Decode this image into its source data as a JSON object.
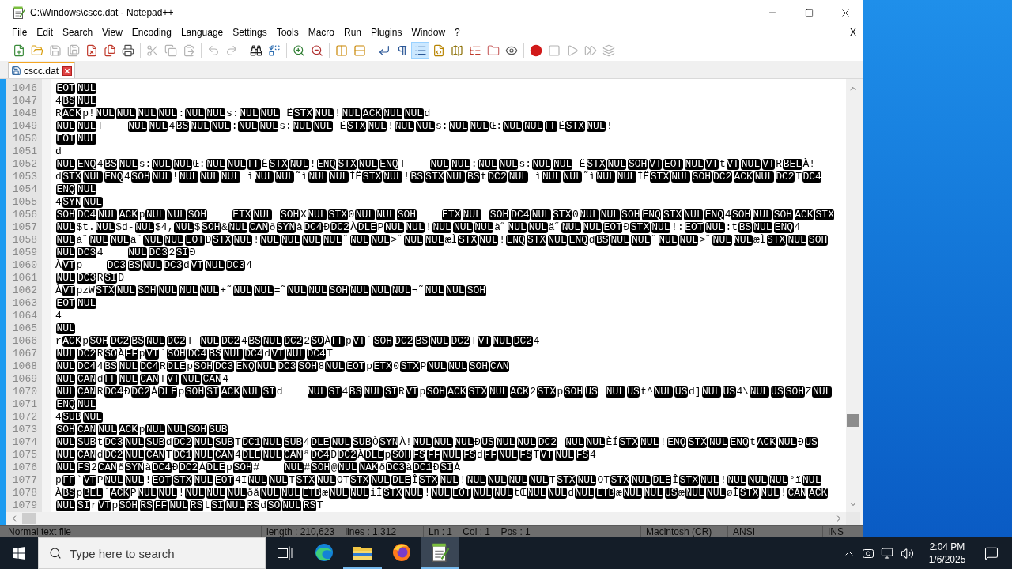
{
  "window": {
    "title": "C:\\Windows\\cscc.dat - Notepad++"
  },
  "menu": {
    "items": [
      "File",
      "Edit",
      "Search",
      "View",
      "Encoding",
      "Language",
      "Settings",
      "Tools",
      "Macro",
      "Run",
      "Plugins",
      "Window",
      "?"
    ],
    "close_glyph": "X"
  },
  "toolbar": [
    [
      {
        "kind": "new",
        "selected": false,
        "disabled": false
      },
      {
        "kind": "open",
        "selected": false,
        "disabled": false
      },
      {
        "kind": "save",
        "selected": false,
        "disabled": true
      },
      {
        "kind": "save-all",
        "selected": false,
        "disabled": true
      },
      {
        "kind": "close",
        "selected": false,
        "disabled": false
      },
      {
        "kind": "close-all",
        "selected": false,
        "disabled": false
      },
      {
        "kind": "print",
        "selected": false,
        "disabled": false
      }
    ],
    [
      {
        "kind": "cut",
        "selected": false,
        "disabled": true
      },
      {
        "kind": "copy",
        "selected": false,
        "disabled": true
      },
      {
        "kind": "paste",
        "selected": false,
        "disabled": true
      }
    ],
    [
      {
        "kind": "undo",
        "selected": false,
        "disabled": true
      },
      {
        "kind": "redo",
        "selected": false,
        "disabled": true
      }
    ],
    [
      {
        "kind": "find",
        "selected": false,
        "disabled": false
      },
      {
        "kind": "replace",
        "selected": false,
        "disabled": false
      }
    ],
    [
      {
        "kind": "zoom-in",
        "selected": false,
        "disabled": false
      },
      {
        "kind": "zoom-out",
        "selected": false,
        "disabled": false
      }
    ],
    [
      {
        "kind": "sync-vertical",
        "selected": false,
        "disabled": false
      },
      {
        "kind": "sync-horizontal",
        "selected": false,
        "disabled": false
      }
    ],
    [
      {
        "kind": "word-wrap",
        "selected": false,
        "disabled": false
      },
      {
        "kind": "all-chars",
        "selected": false,
        "disabled": false
      },
      {
        "kind": "indent-guide",
        "selected": true,
        "disabled": false
      },
      {
        "kind": "user-language",
        "selected": false,
        "disabled": false
      },
      {
        "kind": "doc-map",
        "selected": false,
        "disabled": false
      },
      {
        "kind": "function-list",
        "selected": false,
        "disabled": false
      },
      {
        "kind": "folder-workspace",
        "selected": false,
        "disabled": false
      },
      {
        "kind": "monitoring",
        "selected": false,
        "disabled": false
      }
    ],
    [
      {
        "kind": "record",
        "selected": false,
        "disabled": false
      },
      {
        "kind": "stop",
        "selected": false,
        "disabled": true
      },
      {
        "kind": "play",
        "selected": false,
        "disabled": true
      },
      {
        "kind": "play-multiple",
        "selected": false,
        "disabled": true
      },
      {
        "kind": "save-macro",
        "selected": false,
        "disabled": true
      }
    ]
  ],
  "tabs": [
    {
      "label": "cscc.dat",
      "selected": true
    }
  ],
  "editor": {
    "lines": [
      {
        "number": "1046",
        "tokens": [
          "EOT",
          "NUL"
        ]
      },
      {
        "number": "1047",
        "tokens": [
          {
            "text": "4"
          },
          "BS",
          "NUL"
        ]
      },
      {
        "number": "1048",
        "tokens": [
          {
            "text": "R"
          },
          "ACK",
          {
            "text": "p!"
          },
          "NUL",
          "NUL",
          "NUL",
          "NUL",
          {
            "text": ":"
          },
          "NUL",
          "NUL",
          {
            "text": "s:"
          },
          "NUL",
          {
            "ctrl": "NUL",
            "space_after": true
          },
          {
            "text": "Ë"
          },
          "STX",
          "NUL",
          {
            "text": "!"
          },
          "NUL",
          "ACK",
          "NUL",
          "NUL",
          {
            "text": "d"
          }
        ]
      },
      {
        "number": "1049",
        "tokens": [
          "NUL",
          "NUL",
          {
            "text": "T",
            "tab_after": true
          },
          "NUL",
          "NUL",
          {
            "text": "4"
          },
          "BS",
          "NUL",
          "NUL",
          {
            "text": ":"
          },
          "NUL",
          "NUL",
          {
            "text": "s:"
          },
          "NUL",
          {
            "ctrl": "NUL",
            "space_after": true
          },
          {
            "text": "Ë"
          },
          "STX",
          "NUL",
          {
            "text": "!"
          },
          "NUL",
          "NUL",
          {
            "text": "s:"
          },
          "NUL",
          "NUL",
          {
            "text": "Œ:"
          },
          "NUL",
          "NUL",
          "FF",
          {
            "text": "Ë"
          },
          "STX",
          "NUL",
          {
            "text": "!"
          }
        ]
      },
      {
        "number": "1050",
        "tokens": [
          "EOT",
          "NUL"
        ]
      },
      {
        "number": "1051",
        "tokens": [
          {
            "text": "d"
          }
        ]
      },
      {
        "number": "1052",
        "tokens": [
          "NUL",
          "ENQ",
          {
            "text": "4"
          },
          "BS",
          "NUL",
          {
            "text": "s:"
          },
          "NUL",
          "NUL",
          {
            "text": "Œ:"
          },
          "NUL",
          "NUL",
          "FF",
          {
            "text": "Ë"
          },
          "STX",
          "NUL",
          {
            "text": "!"
          },
          "ENQ",
          "STX",
          "NUL",
          "ENQ",
          {
            "text": "T",
            "tab_after": true
          },
          "NUL",
          "NUL",
          {
            "text": ":"
          },
          "NUL",
          "NUL",
          {
            "text": "s:"
          },
          "NUL",
          {
            "ctrl": "NUL",
            "space_after": true
          },
          {
            "text": "Ë"
          },
          "STX",
          "NUL",
          "SOH",
          "VT",
          "EOT",
          "NUL",
          "VT",
          {
            "text": "t"
          },
          "VT",
          "NUL",
          "VT",
          {
            "text": "R"
          },
          "BEL",
          {
            "text": "À!"
          }
        ]
      },
      {
        "number": "1053",
        "tokens": [
          {
            "text": "d"
          },
          "STX",
          "NUL",
          "ENQ",
          {
            "text": "4"
          },
          "SOH",
          "NUL",
          {
            "text": "!"
          },
          "NUL",
          "NUL",
          {
            "ctrl": "NUL",
            "space_after": true
          },
          {
            "text": "ì"
          },
          "NUL",
          "NUL",
          {
            "text": "˜ì"
          },
          "NUL",
          "NUL",
          {
            "text": "ÌË"
          },
          "STX",
          "NUL",
          {
            "text": "!"
          },
          "BS",
          "STX",
          "NUL",
          "BS",
          {
            "text": "t"
          },
          "DC2",
          {
            "ctrl": "NUL",
            "space_after": true
          },
          {
            "text": "ì"
          },
          "NUL",
          "NUL",
          {
            "text": "˜ì"
          },
          "NUL",
          "NUL",
          {
            "text": "ÌË"
          },
          "STX",
          "NUL",
          "SOH",
          "DC2",
          "ACK",
          "NUL",
          "DC2",
          {
            "text": "T"
          },
          "DC4"
        ]
      },
      {
        "number": "1054",
        "tokens": [
          "ENQ",
          "NUL"
        ]
      },
      {
        "number": "1055",
        "tokens": [
          {
            "text": "4"
          },
          "SYN",
          "NUL"
        ]
      },
      {
        "number": "1056",
        "tokens": [
          "SOH",
          "DC4",
          "NUL",
          "ACK",
          {
            "text": "p"
          },
          "NUL",
          "NUL",
          {
            "ctrl": "SOH",
            "tab_after": true
          },
          "ETX",
          {
            "ctrl": "NUL",
            "space_after": true
          },
          "SOH",
          {
            "text": "X"
          },
          "NUL",
          "STX",
          {
            "text": "0"
          },
          "NUL",
          "NUL",
          {
            "ctrl": "SOH",
            "tab_after": true
          },
          "ETX",
          {
            "ctrl": "NUL",
            "space_after": true
          },
          "SOH",
          "DC4",
          "NUL",
          "STX",
          {
            "text": "0"
          },
          "NUL",
          "NUL",
          "SOH",
          "ENQ",
          "STX",
          "NUL",
          "ENQ",
          {
            "text": "4"
          },
          "SOH",
          "NUL",
          "SOH",
          "ACK",
          "STX"
        ]
      },
      {
        "number": "1057",
        "tokens": [
          "NUL",
          {
            "text": "$t."
          },
          "NUL",
          {
            "text": "$d-"
          },
          "NUL",
          {
            "text": "$4,"
          },
          "NUL",
          {
            "text": "$"
          },
          "SOH",
          {
            "text": "&"
          },
          "NUL",
          "CAN",
          {
            "text": "ð"
          },
          "SYN",
          {
            "text": "à"
          },
          "DC4",
          {
            "text": "Ð"
          },
          "DC2",
          {
            "text": "À"
          },
          "DLE",
          {
            "text": "P"
          },
          "NUL",
          "NUL",
          {
            "text": "!"
          },
          "NUL",
          "NUL",
          "NUL",
          {
            "text": "à˝"
          },
          "NUL",
          "NUL",
          {
            "text": "ä˝"
          },
          "NUL",
          "NUL",
          "EOT",
          {
            "text": "Ð"
          },
          "STX",
          "NUL",
          {
            "text": "!:"
          },
          "EOT",
          "NUL",
          {
            "text": ":t"
          },
          "BS",
          "NUL",
          "ENQ",
          {
            "text": "4"
          }
        ]
      },
      {
        "number": "1058",
        "tokens": [
          "NUL",
          {
            "text": "à˝"
          },
          "NUL",
          "NUL",
          {
            "text": "ä˝"
          },
          "NUL",
          "NUL",
          "EOT",
          {
            "text": "Ð"
          },
          "STX",
          "NUL",
          {
            "text": "!"
          },
          "NUL",
          "NUL",
          "NUL",
          "NUL",
          {
            "text": "˝"
          },
          "NUL",
          "NUL",
          {
            "text": ">˝"
          },
          "NUL",
          "NUL",
          {
            "text": "æÌ"
          },
          "STX",
          "NUL",
          {
            "text": "!"
          },
          "ENQ",
          "STX",
          "NUL",
          "ENQ",
          {
            "text": "d"
          },
          "BS",
          "NUL",
          "NUL",
          {
            "text": "˝"
          },
          "NUL",
          "NUL",
          {
            "text": ">˝"
          },
          "NUL",
          "NUL",
          {
            "text": "æÌ"
          },
          "STX",
          "NUL",
          "SOH"
        ]
      },
      {
        "number": "1059",
        "tokens": [
          "NUL",
          "DC3",
          {
            "text": "4",
            "tab_after": true
          },
          "NUL",
          "DC3",
          {
            "text": "2"
          },
          "SI",
          {
            "text": "Ð"
          }
        ]
      },
      {
        "number": "1060",
        "tokens": [
          {
            "text": "À"
          },
          "VT",
          {
            "text": "p",
            "tab_after": true
          },
          "DC3",
          "BS",
          "NUL",
          "DC3",
          {
            "text": "d"
          },
          "VT",
          "NUL",
          "DC3",
          {
            "text": "4"
          }
        ]
      },
      {
        "number": "1061",
        "tokens": [
          "NUL",
          "DC3",
          {
            "text": "R"
          },
          "SI",
          {
            "text": "Ð"
          }
        ]
      },
      {
        "number": "1062",
        "tokens": [
          {
            "text": "À"
          },
          "VT",
          {
            "text": "pzW"
          },
          "STX",
          "NUL",
          "SOH",
          "NUL",
          "NUL",
          "NUL",
          {
            "text": "+˜"
          },
          "NUL",
          "NUL",
          {
            "text": "=˜"
          },
          "NUL",
          "NUL",
          "SOH",
          "NUL",
          "NUL",
          "NUL",
          {
            "text": "¬˜"
          },
          "NUL",
          "NUL",
          "SOH"
        ]
      },
      {
        "number": "1063",
        "tokens": [
          "EOT",
          "NUL"
        ]
      },
      {
        "number": "1064",
        "tokens": [
          {
            "text": "4"
          }
        ]
      },
      {
        "number": "1065",
        "tokens": [
          "NUL"
        ]
      },
      {
        "number": "1066",
        "tokens": [
          {
            "text": "r"
          },
          "ACK",
          {
            "text": "p"
          },
          "SOH",
          "DC2",
          "BS",
          "NUL",
          "DC2",
          {
            "text": "T",
            "space_after": true
          },
          "NUL",
          "DC2",
          {
            "text": "4"
          },
          "BS",
          "NUL",
          "DC2",
          {
            "text": "2"
          },
          "SO",
          {
            "text": "À"
          },
          "FF",
          {
            "text": "p"
          },
          "VT",
          {
            "text": "`"
          },
          "SOH",
          "DC2",
          "BS",
          "NUL",
          "DC2",
          {
            "text": "T"
          },
          "VT",
          "NUL",
          "DC2",
          {
            "text": "4"
          }
        ]
      },
      {
        "number": "1067",
        "tokens": [
          "NUL",
          "DC2",
          {
            "text": "R"
          },
          "SO",
          {
            "text": "À"
          },
          "FF",
          {
            "text": "p"
          },
          "VT",
          {
            "text": "`"
          },
          "SOH",
          "DC4",
          "BS",
          "NUL",
          "DC4",
          {
            "text": "d"
          },
          "VT",
          "NUL",
          "DC4",
          {
            "text": "T"
          }
        ]
      },
      {
        "number": "1068",
        "tokens": [
          "NUL",
          "DC4",
          {
            "text": "4"
          },
          "BS",
          "NUL",
          "DC4",
          {
            "text": "R"
          },
          "DLE",
          {
            "text": "p"
          },
          "SOH",
          "DC3",
          "ENQ",
          "NUL",
          "DC3",
          "SOH",
          {
            "text": "8"
          },
          "NUL",
          "EOT",
          {
            "text": "p"
          },
          "ETX",
          {
            "text": "0"
          },
          "STX",
          {
            "text": "P"
          },
          "NUL",
          "NUL",
          "SOH",
          "CAN"
        ]
      },
      {
        "number": "1069",
        "tokens": [
          "NUL",
          "CAN",
          {
            "text": "d"
          },
          "FF",
          "NUL",
          "CAN",
          {
            "text": "T"
          },
          "VT",
          "NUL",
          "CAN",
          {
            "text": "4"
          }
        ]
      },
      {
        "number": "1070",
        "tokens": [
          "NUL",
          "CAN",
          {
            "text": "R"
          },
          "DC4",
          {
            "text": "Ð"
          },
          "DC2",
          {
            "text": "À"
          },
          "DLE",
          {
            "text": "p"
          },
          "SOH",
          "SI",
          "ACK",
          "NUL",
          "SI",
          {
            "text": "d",
            "tab_after": true
          },
          "NUL",
          "SI",
          {
            "text": "4"
          },
          "BS",
          "NUL",
          "SI",
          {
            "text": "R"
          },
          "VT",
          {
            "text": "p"
          },
          "SOH",
          "ACK",
          "STX",
          "NUL",
          "ACK",
          {
            "text": "2"
          },
          "STX",
          {
            "text": "p"
          },
          "SOH",
          {
            "ctrl": "US",
            "space_after": true
          },
          "NUL",
          "US",
          {
            "text": "t^"
          },
          "NUL",
          "US",
          {
            "text": "d]"
          },
          "NUL",
          "US",
          {
            "text": "4\\"
          },
          "NUL",
          "US",
          "SOH",
          {
            "text": "Z"
          },
          "NUL"
        ]
      },
      {
        "number": "1071",
        "tokens": [
          "ENQ",
          "NUL"
        ]
      },
      {
        "number": "1072",
        "tokens": [
          {
            "text": "4"
          },
          "SUB",
          "NUL"
        ]
      },
      {
        "number": "1073",
        "tokens": [
          "SOH",
          "CAN",
          "NUL",
          "ACK",
          {
            "text": "p"
          },
          "NUL",
          "NUL",
          "SOH",
          "SUB"
        ]
      },
      {
        "number": "1074",
        "tokens": [
          "NUL",
          "SUB",
          {
            "text": "t"
          },
          "DC3",
          "NUL",
          "SUB",
          {
            "text": "d"
          },
          "DC2",
          "NUL",
          "SUB",
          {
            "text": "T"
          },
          "DC1",
          "NUL",
          "SUB",
          {
            "text": "4"
          },
          "DLE",
          "NUL",
          "SUB",
          {
            "text": "Ò"
          },
          "SYN",
          {
            "text": "À!"
          },
          "NUL",
          "NUL",
          "NUL",
          {
            "text": "Ð"
          },
          "US",
          "NUL",
          "NUL",
          {
            "ctrl": "DC2",
            "space_after": true
          },
          "NUL",
          "NUL",
          {
            "text": "ÈÍ"
          },
          "STX",
          "NUL",
          {
            "text": "!"
          },
          "ENQ",
          "STX",
          "NUL",
          "ENQ",
          {
            "text": "t"
          },
          "ACK",
          "NUL",
          {
            "text": "Ð"
          },
          "US"
        ]
      },
      {
        "number": "1075",
        "tokens": [
          "NUL",
          "CAN",
          {
            "text": "d"
          },
          "DC2",
          "NUL",
          "CAN",
          {
            "text": "T"
          },
          "DC1",
          "NUL",
          "CAN",
          {
            "text": "4"
          },
          "DLE",
          "NUL",
          "CAN",
          {
            "text": "ª"
          },
          "DC4",
          {
            "text": "Ð"
          },
          "DC2",
          {
            "text": "À"
          },
          "DLE",
          {
            "text": "p"
          },
          "SOH",
          "FS",
          "FF",
          "NUL",
          "FS",
          {
            "text": "d"
          },
          "FF",
          "NUL",
          "FS",
          {
            "text": "T"
          },
          "VT",
          "NUL",
          "FS",
          {
            "text": "4"
          }
        ]
      },
      {
        "number": "1076",
        "tokens": [
          "NUL",
          "FS",
          {
            "text": "2"
          },
          "CAN",
          {
            "text": "ð"
          },
          "SYN",
          {
            "text": "à"
          },
          "DC4",
          {
            "text": "Ð"
          },
          "DC2",
          {
            "text": "À"
          },
          "DLE",
          {
            "text": "p"
          },
          "SOH",
          {
            "text": "#",
            "tab_after": true
          },
          "NUL",
          {
            "text": "#"
          },
          "SOH",
          {
            "text": "@"
          },
          "NUL",
          "NAK",
          {
            "text": "ð"
          },
          "DC3",
          {
            "text": "à"
          },
          "DC1",
          {
            "text": "Ð"
          },
          "SI",
          {
            "text": "À"
          }
        ]
      },
      {
        "number": "1077",
        "tokens": [
          {
            "text": "p"
          },
          "FF",
          {
            "text": "`"
          },
          "VT",
          {
            "text": "P"
          },
          "NUL",
          "NUL",
          {
            "text": "!"
          },
          "EOT",
          "STX",
          "NUL",
          "EOT",
          {
            "text": "4I"
          },
          "NUL",
          "NUL",
          {
            "text": "T"
          },
          "STX",
          "NUL",
          {
            "text": "OT"
          },
          "STX",
          "NUL",
          "DLE",
          {
            "text": "Î"
          },
          "STX",
          "NUL",
          {
            "text": "!"
          },
          "NUL",
          "NUL",
          "NUL",
          "NUL",
          {
            "text": "T"
          },
          "STX",
          "NUL",
          {
            "text": "OT"
          },
          "STX",
          "NUL",
          "DLE",
          {
            "text": "Î"
          },
          "STX",
          "NUL",
          {
            "text": "!"
          },
          "NUL",
          "NUL",
          "NUL",
          {
            "text": "°ï"
          },
          "NUL"
        ]
      },
      {
        "number": "1078",
        "tokens": [
          {
            "text": "À"
          },
          "BS",
          {
            "text": "p"
          },
          "BEL",
          {
            "text": "`"
          },
          "ACK",
          {
            "text": "P"
          },
          "NUL",
          "NUL",
          {
            "text": "!"
          },
          "NUL",
          "NUL",
          "NUL",
          {
            "text": "ðå"
          },
          "NUL",
          "NUL",
          "ETB",
          {
            "text": "æ"
          },
          "NUL",
          "NUL",
          {
            "text": "iÎ"
          },
          "STX",
          "NUL",
          {
            "text": "!"
          },
          "NUL",
          "EOT",
          "NUL",
          "NUL",
          {
            "text": "tŒ"
          },
          "NUL",
          "NUL",
          {
            "text": "d"
          },
          "NUL",
          "ETB",
          {
            "text": "æ"
          },
          "NUL",
          "NUL",
          "US",
          {
            "text": "æ"
          },
          "NUL",
          "NUL",
          {
            "text": "øÎ"
          },
          "STX",
          "NUL",
          {
            "text": "!"
          },
          "CAN",
          "ACK"
        ]
      },
      {
        "number": "1079",
        "tokens": [
          "NUL",
          "SI",
          {
            "text": "r"
          },
          "VT",
          {
            "text": "p"
          },
          "SOH",
          "RS",
          "FF",
          "NUL",
          "RS",
          {
            "text": "t"
          },
          "SI",
          "NUL",
          "RS",
          {
            "text": "d"
          },
          "SO",
          "NUL",
          "RS",
          {
            "text": "T"
          }
        ]
      }
    ]
  },
  "status_bar": [
    "Normal text file",
    "length : 210,623    lines : 1,312",
    "Ln : 1    Col : 1    Pos : 1",
    "Macintosh (CR)",
    "ANSI",
    "INS"
  ],
  "taskbar": {
    "search": {
      "placeholder": "Type here to search"
    },
    "apps": [
      {
        "kind": "edge",
        "running": false,
        "selected": false
      },
      {
        "kind": "explorer",
        "running": true,
        "selected": false
      },
      {
        "kind": "firefox",
        "running": false,
        "selected": false
      },
      {
        "kind": "notepad",
        "running": true,
        "selected": true
      }
    ],
    "clock": {
      "time": "2:04 PM",
      "date": "1/6/2025"
    }
  }
}
